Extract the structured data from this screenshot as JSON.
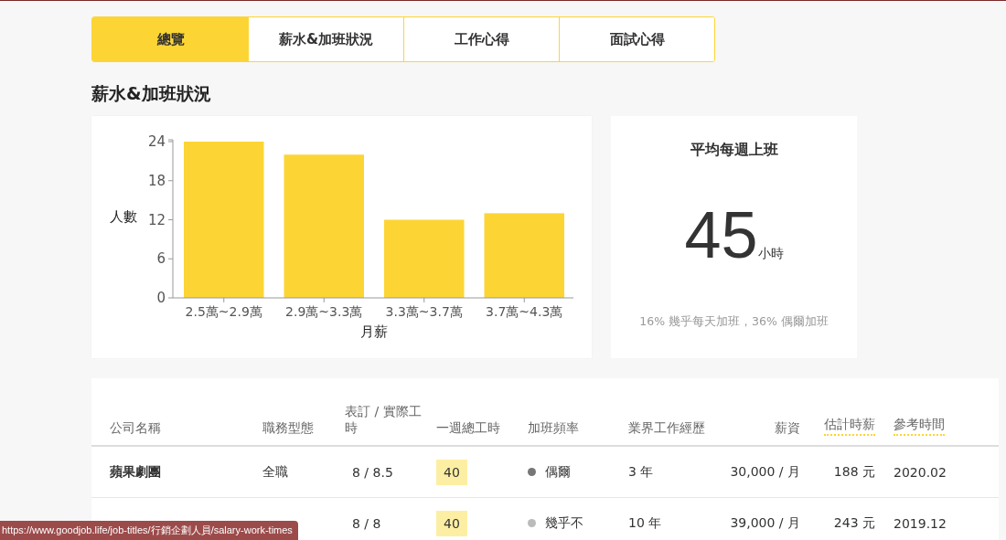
{
  "tabs": [
    {
      "label": "總覽",
      "selected": true
    },
    {
      "label": "薪水&加班狀況",
      "selected": false
    },
    {
      "label": "工作心得",
      "selected": false
    },
    {
      "label": "面試心得",
      "selected": false
    }
  ],
  "section_title": "薪水&加班狀況",
  "salary_chart": {
    "chart_data": {
      "type": "bar",
      "xlabel": "月薪",
      "ylabel": "人數",
      "categories": [
        "2.5萬~2.9萬",
        "2.9萬~3.3萬",
        "3.3萬~3.7萬",
        "3.7萬~4.3萬"
      ],
      "values": [
        24,
        22,
        12,
        13
      ],
      "ylim": [
        0,
        24
      ],
      "yticks": [
        0,
        6,
        12,
        18,
        24
      ]
    }
  },
  "weekly_hours": {
    "title": "平均每週上班",
    "value": "45",
    "unit": "小時",
    "note": "16% 幾乎每天加班，36% 偶爾加班"
  },
  "table": {
    "columns": [
      {
        "label": "公司名稱",
        "hint": false
      },
      {
        "label": "職務型態",
        "hint": false
      },
      {
        "label": "表訂 / 實際工時",
        "hint": false
      },
      {
        "label": "一週總工時",
        "hint": false
      },
      {
        "label": "加班頻率",
        "hint": false
      },
      {
        "label": "業界工作經歷",
        "hint": false
      },
      {
        "label": "薪資",
        "hint": false
      },
      {
        "label": "估計時薪",
        "hint": true
      },
      {
        "label": "參考時間",
        "hint": true
      }
    ],
    "rows": [
      {
        "company": "蘋果劇團",
        "job_type": "全職",
        "hours": "8 / 8.5",
        "weekly": "40",
        "overtime": {
          "label": "偶爾",
          "color": "#777777"
        },
        "experience": "3 年",
        "salary": "30,000 / 月",
        "hourly": "188 元",
        "date": "2020.02"
      },
      {
        "hours": "8 / 8",
        "weekly": "40",
        "overtime": {
          "label": "幾乎不",
          "color": "#bbbbbb"
        },
        "experience": "10 年",
        "salary": "39,000 / 月",
        "hourly": "243 元",
        "date": "2019.12"
      }
    ]
  },
  "status_url": "https://www.goodjob.life/job-titles/行銷企劃人員/salary-work-times"
}
